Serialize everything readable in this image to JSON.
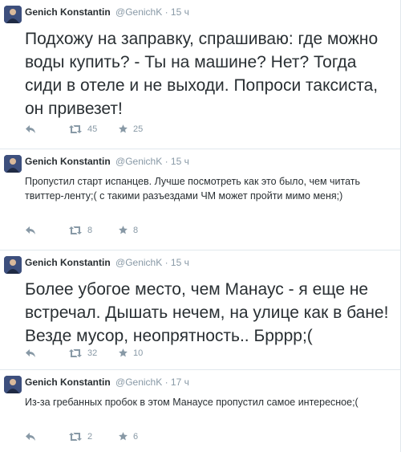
{
  "tweets": [
    {
      "name": "Genich Konstantin",
      "handle": "@GenichK",
      "separator": "·",
      "time": "15 ч",
      "text": "Подхожу на заправку, спрашиваю: где можно воды купить? - Ты на машине? Нет? Тогда сиди в отеле и не выходи. Попроси таксиста, он привезет!",
      "retweets": "45",
      "favorites": "25"
    },
    {
      "name": "Genich Konstantin",
      "handle": "@GenichK",
      "separator": "·",
      "time": "15 ч",
      "text": "Пропустил старт испанцев. Лучше посмотреть как это было, чем читать твиттер-ленту;( с такими разъездами ЧМ может пройти мимо меня;)",
      "retweets": "8",
      "favorites": "8"
    },
    {
      "name": "Genich Konstantin",
      "handle": "@GenichK",
      "separator": "·",
      "time": "15 ч",
      "text": "Более убогое место, чем Манаус - я еще не встречал. Дышать нечем, на улице как в бане! Везде мусор, неопрятность.. Брррр;(",
      "retweets": "32",
      "favorites": "10"
    },
    {
      "name": "Genich Konstantin",
      "handle": "@GenichK",
      "separator": "·",
      "time": "17 ч",
      "text": "Из-за гребанных пробок в этом Манаусе пропустил самое интересное;(",
      "retweets": "2",
      "favorites": "6"
    }
  ],
  "icons": {
    "reply": "reply-icon",
    "retweet": "retweet-icon",
    "favorite": "star-icon"
  },
  "colors": {
    "text": "#292f33",
    "muted": "#8899a6",
    "divider": "#e1e8ed"
  }
}
